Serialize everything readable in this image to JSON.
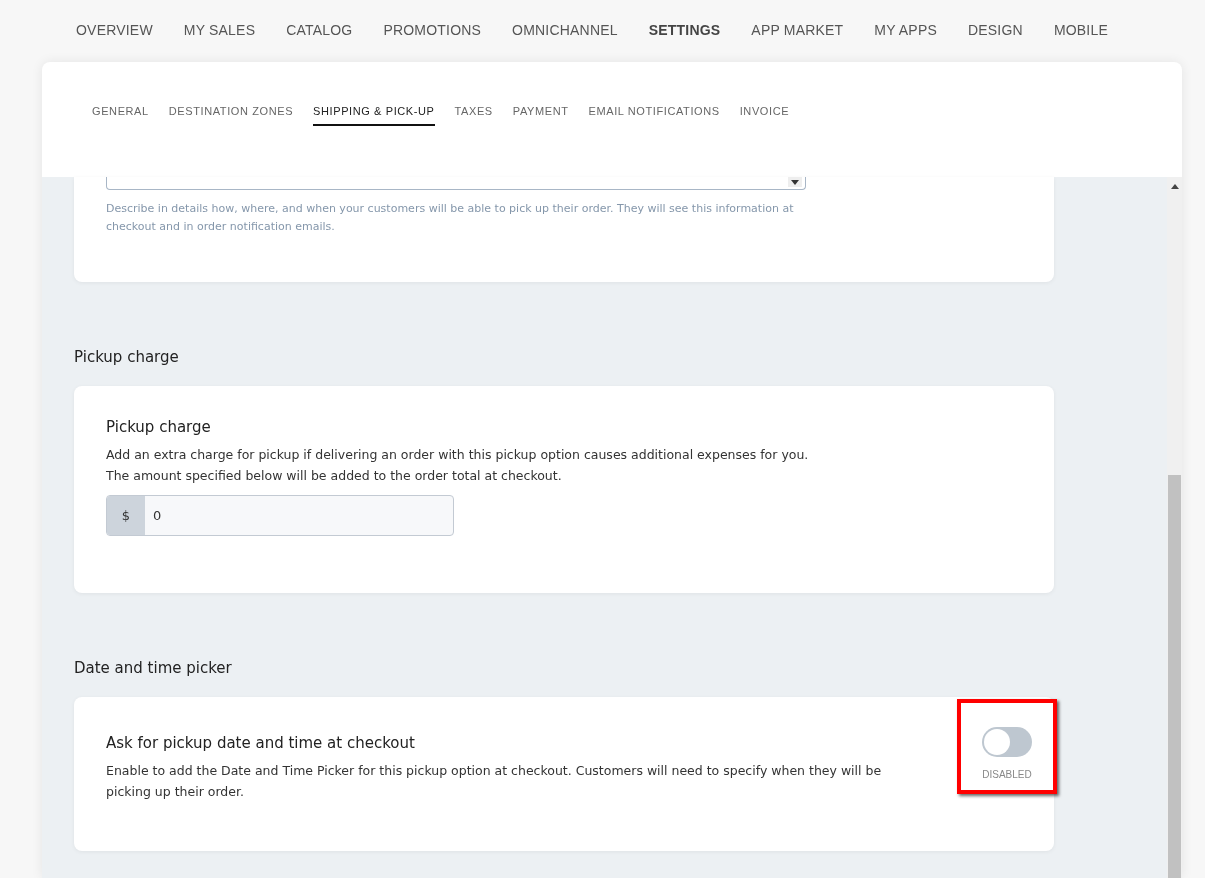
{
  "top_nav": [
    {
      "label": "OVERVIEW",
      "selected": false
    },
    {
      "label": "MY SALES",
      "selected": false
    },
    {
      "label": "CATALOG",
      "selected": false
    },
    {
      "label": "PROMOTIONS",
      "selected": false
    },
    {
      "label": "OMNICHANNEL",
      "selected": false
    },
    {
      "label": "SETTINGS",
      "selected": true
    },
    {
      "label": "APP MARKET",
      "selected": false
    },
    {
      "label": "MY APPS",
      "selected": false
    },
    {
      "label": "DESIGN",
      "selected": false
    },
    {
      "label": "MOBILE",
      "selected": false
    }
  ],
  "settings_tabs": [
    {
      "label": "GENERAL",
      "selected": false
    },
    {
      "label": "DESTINATION ZONES",
      "selected": false
    },
    {
      "label": "SHIPPING & PICK-UP",
      "selected": true
    },
    {
      "label": "TAXES",
      "selected": false
    },
    {
      "label": "PAYMENT",
      "selected": false
    },
    {
      "label": "EMAIL NOTIFICATIONS",
      "selected": false
    },
    {
      "label": "INVOICE",
      "selected": false
    }
  ],
  "instructions_card": {
    "hint": "Describe in details how, where, and when your customers will be able to pick up their order. They will see this information at checkout and in order notification emails."
  },
  "sections": [
    {
      "heading": "Pickup charge",
      "kind": "charge",
      "title": "Pickup charge",
      "description": "Add an extra charge for pickup if delivering an order with this pickup option causes additional expenses for you.\nThe amount specified below will be added to the order total at checkout.",
      "currency": "$",
      "value": "0"
    },
    {
      "heading": "Date and time picker",
      "kind": "toggle",
      "title": "Ask for pickup date and time at checkout",
      "description": "Enable to add the Date and Time Picker for this pickup option at checkout. Customers will need to specify when they will be picking up their order.",
      "on": false,
      "state_label": "DISABLED",
      "highlighted": true
    }
  ]
}
